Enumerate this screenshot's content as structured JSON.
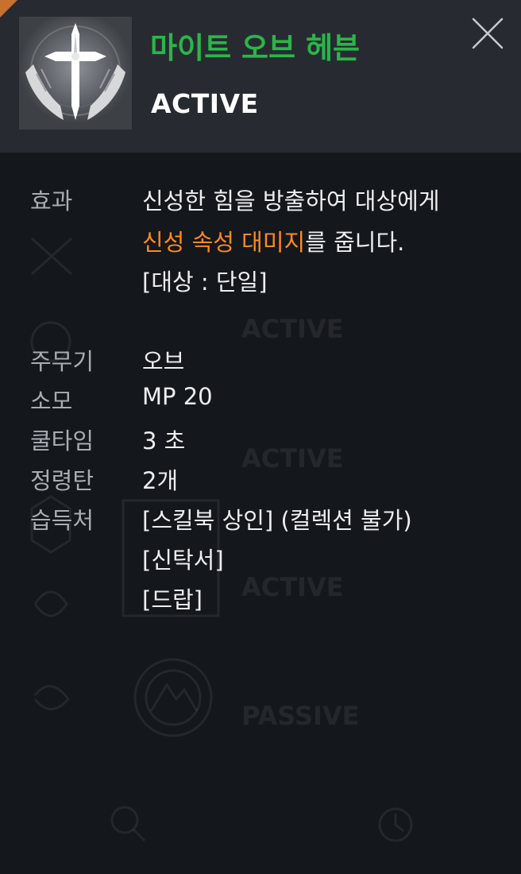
{
  "background": {
    "faded_labels": [
      "ACTIVE",
      "ACTIVE",
      "ACTIVE",
      "PASSIVE"
    ]
  },
  "skill": {
    "title": "마이트 오브 헤븐",
    "type": "ACTIVE",
    "icon": "holy-cross-hands-icon"
  },
  "close": {
    "icon": "close-icon"
  },
  "effect": {
    "label": "효과",
    "line1": "신성한 힘을 방출하여 대상에게",
    "line2_highlight": "신성 속성 대미지",
    "line2_rest": "를 줍니다.",
    "line3": "[대상 : 단일]"
  },
  "details": [
    {
      "label": "주무기",
      "value": "오브"
    },
    {
      "label": "소모",
      "value": "MP 20"
    },
    {
      "label": "쿨타임",
      "value": "3 초"
    },
    {
      "label": "정령탄",
      "value": "2개"
    }
  ],
  "acquire": {
    "label": "습득처",
    "sources": [
      "[스킬북 상인] (컬렉션 불가)",
      "[신탁서]",
      "[드랍]"
    ]
  },
  "colors": {
    "title": "#2bb54a",
    "highlight": "#ff8a1f",
    "header_bg": "#272b31",
    "panel_bg": "#14171b"
  }
}
